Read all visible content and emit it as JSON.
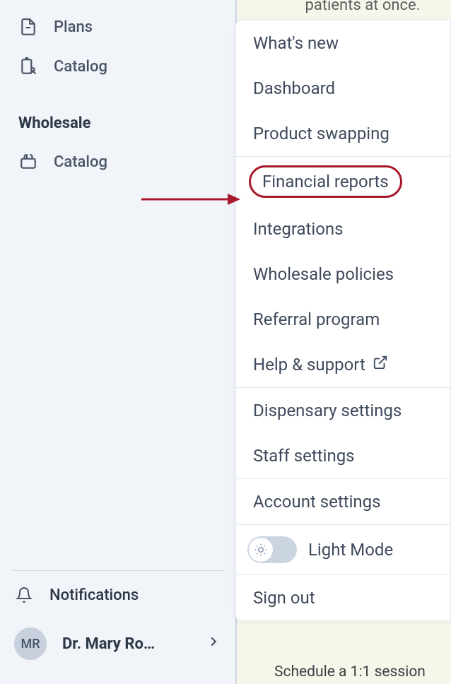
{
  "sidebar": {
    "items": [
      {
        "label": "Plans",
        "icon": "file-icon"
      },
      {
        "label": "Catalog",
        "icon": "clipboard-user-icon"
      }
    ],
    "section_label": "Wholesale",
    "section_items": [
      {
        "label": "Catalog",
        "icon": "box-icon"
      }
    ],
    "notifications_label": "Notifications",
    "user": {
      "initials": "MR",
      "display_name": "Dr. Mary Ro…"
    }
  },
  "dropdown": {
    "group1": [
      {
        "label": "What's new"
      },
      {
        "label": "Dashboard"
      },
      {
        "label": "Product swapping"
      }
    ],
    "group2": [
      {
        "label": "Financial reports",
        "highlighted": true
      },
      {
        "label": "Integrations"
      },
      {
        "label": "Wholesale policies"
      },
      {
        "label": "Referral program"
      },
      {
        "label": "Help & support",
        "external": true
      }
    ],
    "group3": [
      {
        "label": "Dispensary settings"
      },
      {
        "label": "Staff settings"
      }
    ],
    "group4": [
      {
        "label": "Account settings"
      }
    ],
    "theme_label": "Light Mode",
    "signout_label": "Sign out"
  },
  "background": {
    "top_text": "patients at once.",
    "bottom_text": "Schedule a 1:1 session"
  },
  "colors": {
    "highlight": "#a8192e"
  }
}
